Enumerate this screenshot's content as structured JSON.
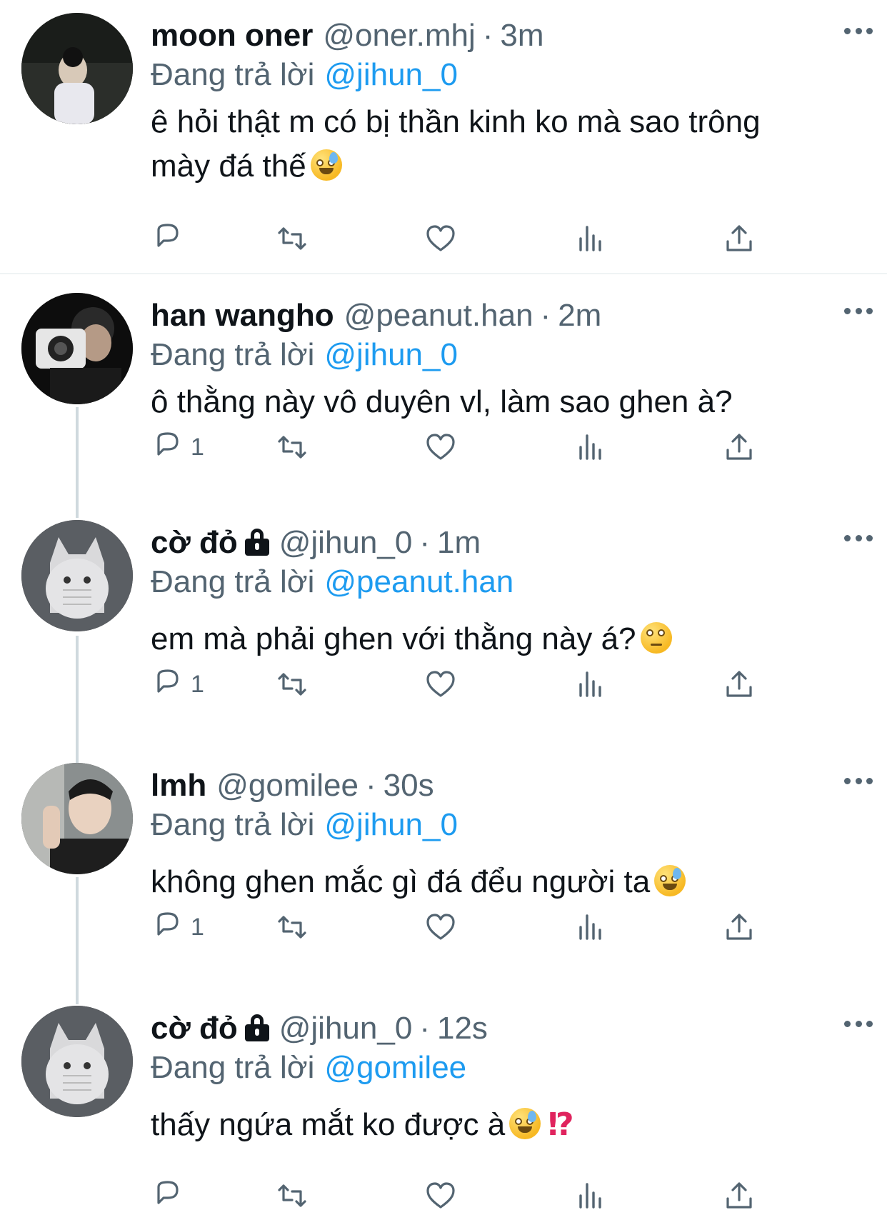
{
  "tweets": [
    {
      "name": "moon oner",
      "locked": false,
      "handle": "@oner.mhj",
      "time": "3m",
      "reply_prefix": "Đang trả lời",
      "reply_target": "@jihun_0",
      "text_lines": [
        "ê hỏi thật m có bị thần kinh ko mà sao trông",
        "mày đá thế"
      ],
      "emoji": "grinning-sweat-emoji",
      "reply_count": ""
    },
    {
      "name": "han wangho",
      "locked": false,
      "handle": "@peanut.han",
      "time": "2m",
      "reply_prefix": "Đang trả lời",
      "reply_target": "@jihun_0",
      "text_lines": [
        "ô thằng này vô duyên vl, làm sao ghen à?"
      ],
      "reply_count": "1"
    },
    {
      "name": "cờ đỏ",
      "locked": true,
      "handle": "@jihun_0",
      "time": "1m",
      "reply_prefix": "Đang trả lời",
      "reply_target": "@peanut.han",
      "text_lines": [
        "em mà phải ghen với thằng này á?"
      ],
      "emoji": "eye-roll-emoji",
      "reply_count": "1"
    },
    {
      "name": "lmh",
      "locked": false,
      "handle": "@gomilee",
      "time": "30s",
      "reply_prefix": "Đang trả lời",
      "reply_target": "@jihun_0",
      "text_lines": [
        "không ghen mắc gì đá đểu người ta"
      ],
      "emoji": "grinning-sweat-emoji",
      "reply_count": "1"
    },
    {
      "name": "cờ đỏ",
      "locked": true,
      "handle": "@jihun_0",
      "time": "12s",
      "reply_prefix": "Đang trả lời",
      "reply_target": "@gomilee",
      "text_lines": [
        "thấy ngứa mắt ko được à"
      ],
      "emoji": "grinning-sweat-emoji",
      "extra_symbol": "⁉",
      "reply_count": ""
    }
  ],
  "icons": {
    "reply": "reply-icon",
    "retweet": "retweet-icon",
    "like": "like-icon",
    "views": "views-icon",
    "share": "share-icon",
    "more": "more-icon",
    "lock": "lock-icon"
  },
  "colors": {
    "link": "#1d9bf0",
    "secondary": "#536471",
    "text": "#0f1419",
    "thread_line": "#cfd9de"
  }
}
